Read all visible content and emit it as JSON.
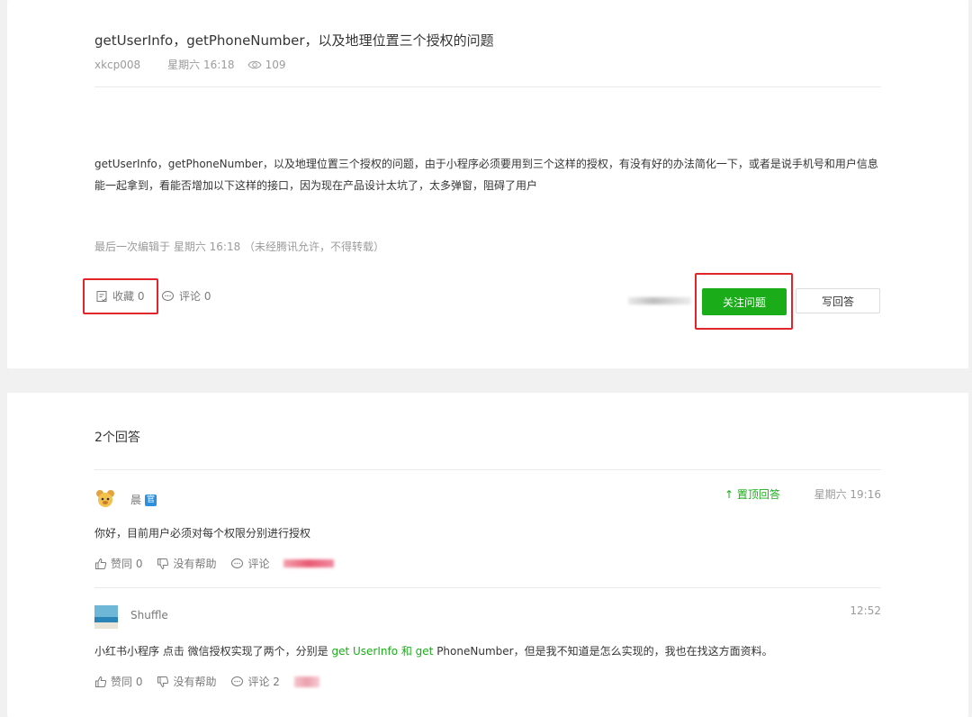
{
  "question": {
    "title": "getUserInfo，getPhoneNumber，以及地理位置三个授权的问题",
    "author": "xkcp008",
    "time": "星期六 16:18",
    "views": "109",
    "body": "getUserInfo，getPhoneNumber，以及地理位置三个授权的问题，由于小程序必须要用到三个这样的授权，有没有好的办法简化一下，或者是说手机号和用户信息能一起拿到，看能否增加以下这样的接口，因为现在产品设计太坑了，太多弹窗，阻碍了用户",
    "edited": "最后一次编辑于  星期六 16:18  （未经腾讯允许，不得转载）",
    "collect_label": "收藏 0",
    "comment_label": "评论 0",
    "follow_button": "关注问题",
    "answer_button": "写回答"
  },
  "answers_section": {
    "count_label": "2个回答",
    "answers": [
      {
        "name": "晨",
        "badge": "官",
        "pin_label": "置顶回答",
        "time": "星期六 19:16",
        "body": "你好，目前用户必须对每个权限分别进行授权",
        "like": "赞同 0",
        "unhelpful": "没有帮助",
        "comment": "评论"
      },
      {
        "name": "Shuffle",
        "time": "12:52",
        "body_part1": "小红书小程序 点击 微信授权实现了两个，分别是 ",
        "body_green": "get UserInfo 和  get",
        "body_part2": " PhoneNumber，但是我不知道是怎么实现的，我也在找这方面资料。",
        "like": "赞同 0",
        "unhelpful": "没有帮助",
        "comment": "评论 2"
      }
    ]
  },
  "colors": {
    "accent_green": "#1aad19",
    "highlight_red": "#e0262a",
    "badge_blue": "#2e8fdc"
  },
  "icons": [
    "eye-icon",
    "collect-icon",
    "comment-icon",
    "like-icon",
    "dislike-icon",
    "pin-arrow-icon"
  ]
}
